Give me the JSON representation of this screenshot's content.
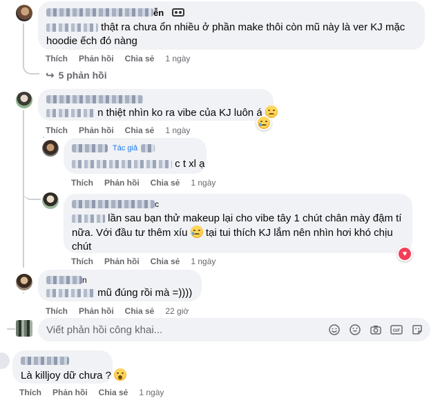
{
  "comments": [
    {
      "name_suffix": "ễn",
      "text": "thật ra chưa ổn nhiều ở phần make thôi còn mũ này là ver KJ mặc hoodie ếch đó nàng",
      "actions": [
        "Thích",
        "Phản hồi",
        "Chia sẻ"
      ],
      "time": "1 ngày",
      "replies_label": "5 phản hồi"
    },
    {
      "text": "n thiệt nhìn ko ra vibe của KJ luôn á",
      "actions": [
        "Thích",
        "Phản hồi",
        "Chia sẻ"
      ],
      "time": "1 ngày",
      "replies": [
        {
          "author_tag": "Tác giả",
          "text": "c t xl ạ",
          "actions": [
            "Thích",
            "Phản hồi",
            "Chia sẻ"
          ],
          "time": "1 ngày"
        },
        {
          "name_suffix": "c",
          "text_line1": "lần sau bạn thử makeup lại cho vibe tây 1 chút chân mày đậm tí",
          "text_line2": "nữa. Với đầu tư thêm xíu",
          "text_line2b": "tại tui thích KJ lắm nên nhìn hơi khó chịu",
          "text_line3": "chút",
          "actions": [
            "Thích",
            "Phản hồi",
            "Chia sẻ"
          ],
          "time": "1 ngày"
        }
      ]
    },
    {
      "name_suffix": "n",
      "text": "mũ đúng rồi mà =))))",
      "actions": [
        "Thích",
        "Phản hồi",
        "Chia sẻ"
      ],
      "time": "22 giờ"
    },
    {
      "text": "Là killjoy dữ chưa ?",
      "actions": [
        "Thích",
        "Phản hồi",
        "Chia sẻ"
      ],
      "time": "1 ngày"
    }
  ],
  "reply_input": {
    "placeholder": "Viết phản hồi công khai..."
  },
  "icons": [
    "reply-arrow-icon",
    "smile-face-icon",
    "sticker-icon",
    "camera-icon",
    "gif-icon",
    "sticker-box-icon",
    "heart-reaction-icon",
    "sad-emoji-icon",
    "cry-emoji-icon",
    "surprised-emoji-icon"
  ],
  "colors": {
    "bubble": "#f0f2f5",
    "meta": "#65676b",
    "text": "#050505",
    "heart": "#f33e58"
  }
}
